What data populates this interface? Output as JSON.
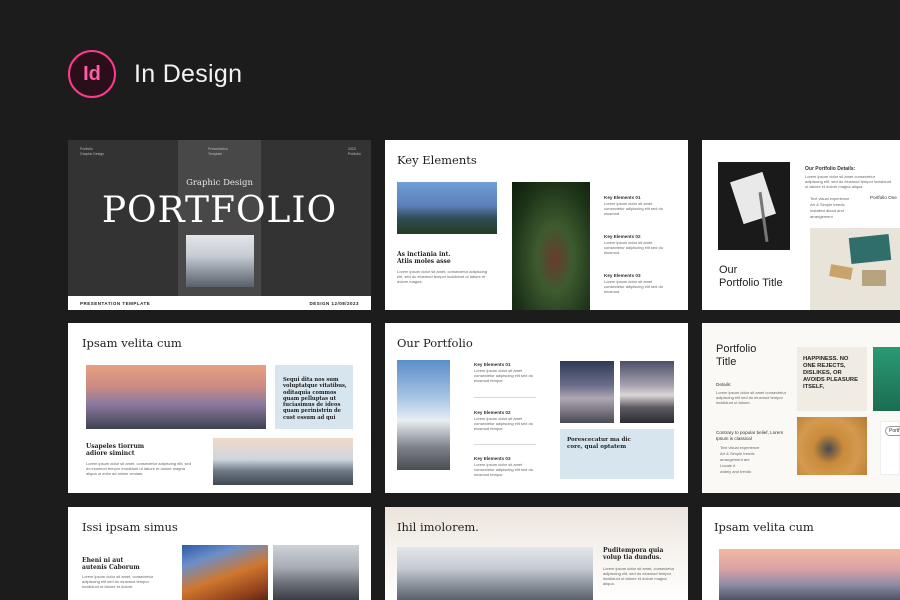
{
  "header": {
    "logo_text": "Id",
    "title": "In Design",
    "accent_color": "#ff3a8c"
  },
  "slide1": {
    "top_left": "Portfolio\nGraphic Design",
    "top_center": "Presentation\nTemplate",
    "top_right": "2023\nPortfolio",
    "subtitle": "Graphic Design",
    "title": "PORTFOLIO",
    "footer_left": "PRESENTATION TEMPLATE",
    "footer_right": "DESIGN 12/08/2023"
  },
  "slide2": {
    "title": "Key Elements",
    "heading": "As inctiania int. Atiis moles asse",
    "body": "Lorem ipsum dolor sit amet, consectetur adipiscing elit, sed do eiusmod tempor incididunt ut labore et dolore magna.",
    "items": [
      {
        "label": "Key Elements 01",
        "text": "Lorem ipsum dolor sit amet consectetur adipiscing elit sed do eiusmod."
      },
      {
        "label": "Key Elements 02",
        "text": "Lorem ipsum dolor sit amet consectetur adipiscing elit sed do eiusmod."
      },
      {
        "label": "Key Elements 03",
        "text": "Lorem ipsum dolor sit amet consectetur adipiscing elit sed do eiusmod."
      }
    ]
  },
  "slide3": {
    "details_heading": "Our Portfolio Details:",
    "details_text": "Lorem ipsum dolor sit amet consectetur adipiscing elit, sed do eiusmod tempor incididunt ut labore et dolore magna aliqua.",
    "bullets": [
      "Text visual experience",
      "Art & Simple trends",
      "Installed about and",
      "arrangement"
    ],
    "side_label": "Portfolio One",
    "title_line1": "Our",
    "title_line2": "Portfolio Title"
  },
  "slide4": {
    "title": "Ipsam velita cum",
    "quote": "Sequi dita nos sum voluptatque vitatibus, oditaquia commos quam pelluptas ut fuciasimus de ideos quam perinistrin de cust essum ad qui",
    "heading": "Usapeles tiorrum adiore siminct",
    "body": "Lorem ipsum dolor sit amet, consectetur adipiscing elit, sed do eiusmod tempor incididunt ut labore et dolore magna aliqua ut enim ad minim veniam."
  },
  "slide5": {
    "title": "Our Portfolio",
    "items": [
      {
        "label": "Key Elements 01",
        "text": "Lorem ipsum dolor sit amet consectetur adipiscing elit sed do eiusmod tempor."
      },
      {
        "label": "Key Elements 02",
        "text": "Lorem ipsum dolor sit amet consectetur adipiscing elit sed do eiusmod tempor."
      },
      {
        "label": "Key Elements 03",
        "text": "Lorem ipsum dolor sit amet consectetur adipiscing elit sed do eiusmod tempor."
      }
    ],
    "quote": "Porescecatur ma dic core, qual optatem"
  },
  "slide6": {
    "title_line1": "Portfolio",
    "title_line2": "Title",
    "details_label": "Details:",
    "details_text": "Lorem ipsum dolor sit amet consectetur adipiscing elit sed do eiusmod tempor incididunt ut labore.",
    "contrary": "Contrary to popular belief, Lorem Ipsum is classical",
    "bullets": [
      "Text visual experience",
      "Art & Simple trends",
      "arrangement are",
      "Locate it",
      "widely and trends"
    ],
    "quote": "HAPPINESS. NO ONE REJECTS, DISLIKES, OR AVOIDS PLEASURE ITSELF,",
    "pill": "Portf"
  },
  "slide7": {
    "title": "Issi ipsam simus",
    "heading": "Eheni ni aut autenis Caborum",
    "body": "Lorem ipsum dolor sit amet, consectetur adipiscing elit sed do eiusmod tempor incididunt ut labore et dolore."
  },
  "slide8": {
    "title": "Ihil imolorem.",
    "heading": "Puditempora quia volup tia dundus.",
    "body": "Lorem ipsum dolor sit amet, consectetur adipiscing elit, sed do eiusmod tempor incididunt ut labore et dolore magna aliqua."
  },
  "slide9": {
    "title": "Ipsam velita cum"
  }
}
